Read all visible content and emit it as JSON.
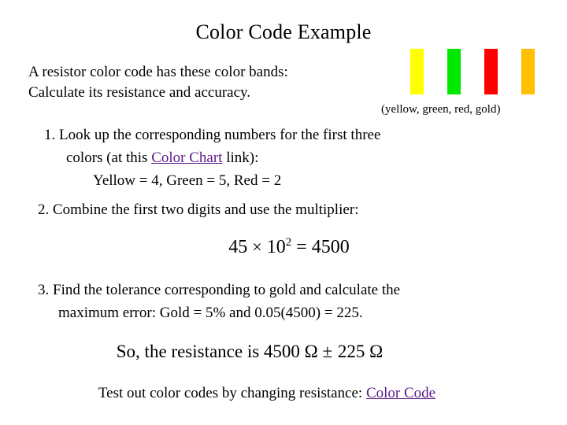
{
  "slide": {
    "title": "Color Code Example",
    "background_color": "#FFFFFF",
    "text_color": "#000000",
    "link_color": "#5B1A8B"
  },
  "intro": {
    "line1": "A resistor color code has these color bands:",
    "line2": "Calculate its resistance and accuracy."
  },
  "bands": {
    "caption": "(yellow, green, red, gold)",
    "items": [
      {
        "name": "yellow",
        "color": "#FFFF00"
      },
      {
        "name": "green",
        "color": "#00E800"
      },
      {
        "name": "red",
        "color": "#FF0000"
      },
      {
        "name": "gold",
        "color": "#FFC000"
      }
    ]
  },
  "steps": {
    "step1": {
      "line1": "1. Look up the corresponding numbers for the first three",
      "line2_before_link": "colors (at this ",
      "line2_link": "Color Chart",
      "line2_after_link": " link):",
      "line3": "Yellow = 4,  Green = 5,  Red = 2"
    },
    "step2": {
      "line1": "2. Combine the first two digits and use the multiplier:"
    },
    "equation": {
      "lhs_coefficient": "45",
      "times_symbol": "×",
      "base": "10",
      "exponent": "2",
      "equals": "= 4500"
    },
    "step3": {
      "line1": "3. Find the tolerance corresponding to gold and calculate the",
      "line2": "maximum error:   Gold = 5% and  0.05(4500) = 225."
    }
  },
  "result": {
    "text_before": "So, the resistance is 4500 Ω",
    "plus_minus": "±",
    "text_after": "225 Ω"
  },
  "footer": {
    "text": "Test out color codes by changing resistance: ",
    "link": "Color Code"
  }
}
